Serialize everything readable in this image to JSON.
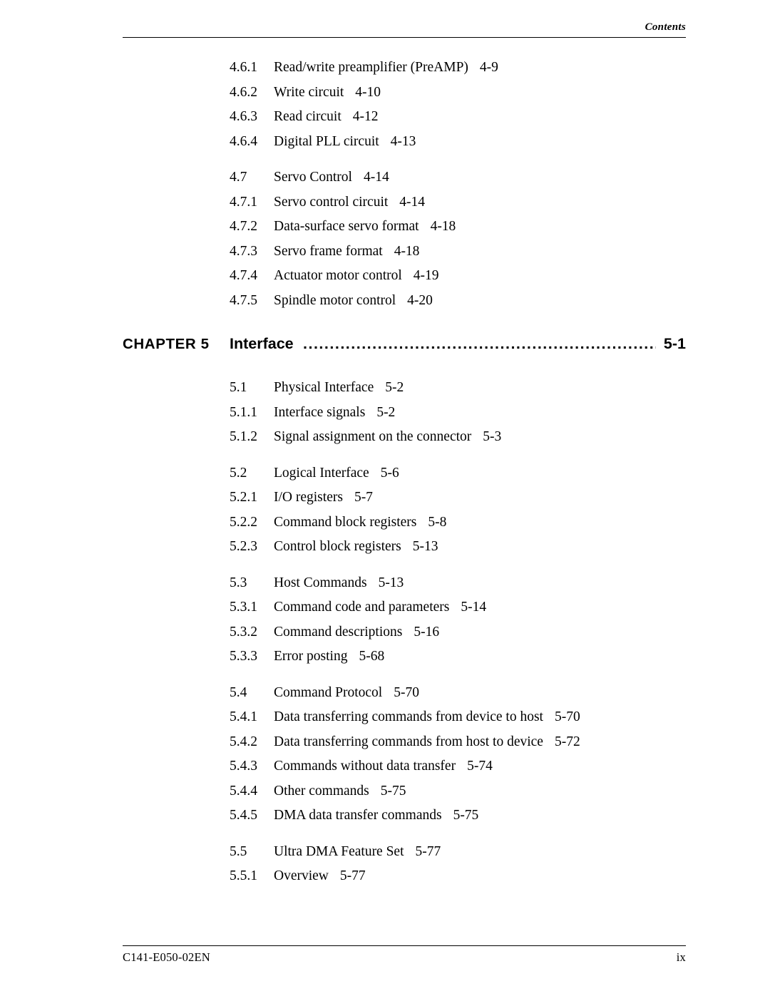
{
  "header": {
    "text": "Contents"
  },
  "footer": {
    "doc_id": "C141-E050-02EN",
    "page_number": "ix"
  },
  "chapter": {
    "label": "CHAPTER 5",
    "title": "Interface",
    "dots": "...........................................................................................",
    "page": "5-1"
  },
  "entries_top": [
    {
      "num": "4.6.1",
      "title": "Read/write preamplifier (PreAMP)",
      "page": "4-9"
    },
    {
      "num": "4.6.2",
      "title": "Write circuit",
      "page": "4-10"
    },
    {
      "num": "4.6.3",
      "title": "Read circuit",
      "page": "4-12"
    },
    {
      "num": "4.6.4",
      "title": "Digital PLL circuit",
      "page": "4-13"
    },
    {
      "gap": true
    },
    {
      "num": "4.7",
      "title": "Servo Control",
      "page": "4-14"
    },
    {
      "num": "4.7.1",
      "title": "Servo control circuit",
      "page": "4-14"
    },
    {
      "num": "4.7.2",
      "title": "Data-surface servo format",
      "page": "4-18"
    },
    {
      "num": "4.7.3",
      "title": "Servo frame format",
      "page": "4-18"
    },
    {
      "num": "4.7.4",
      "title": "Actuator motor control",
      "page": "4-19"
    },
    {
      "num": "4.7.5",
      "title": "Spindle motor control",
      "page": "4-20"
    }
  ],
  "entries_bottom": [
    {
      "num": "5.1",
      "title": "Physical Interface",
      "page": "5-2"
    },
    {
      "num": "5.1.1",
      "title": "Interface signals",
      "page": "5-2"
    },
    {
      "num": "5.1.2",
      "title": "Signal assignment on the connector",
      "page": "5-3"
    },
    {
      "gap": true
    },
    {
      "num": "5.2",
      "title": "Logical Interface",
      "page": "5-6"
    },
    {
      "num": "5.2.1",
      "title": "I/O registers",
      "page": "5-7"
    },
    {
      "num": "5.2.2",
      "title": "Command block registers",
      "page": "5-8"
    },
    {
      "num": "5.2.3",
      "title": "Control block registers",
      "page": "5-13"
    },
    {
      "gap": true
    },
    {
      "num": "5.3",
      "title": "Host Commands",
      "page": "5-13"
    },
    {
      "num": "5.3.1",
      "title": "Command code and parameters",
      "page": "5-14"
    },
    {
      "num": "5.3.2",
      "title": "Command descriptions",
      "page": "5-16"
    },
    {
      "num": "5.3.3",
      "title": "Error posting",
      "page": "5-68"
    },
    {
      "gap": true
    },
    {
      "num": "5.4",
      "title": "Command Protocol",
      "page": "5-70"
    },
    {
      "num": "5.4.1",
      "title": "Data transferring commands from device to host",
      "page": "5-70"
    },
    {
      "num": "5.4.2",
      "title": "Data transferring commands from host to device",
      "page": "5-72"
    },
    {
      "num": "5.4.3",
      "title": "Commands without data transfer",
      "page": "5-74"
    },
    {
      "num": "5.4.4",
      "title": "Other commands",
      "page": "5-75"
    },
    {
      "num": "5.4.5",
      "title": "DMA data transfer commands",
      "page": "5-75"
    },
    {
      "gap": true
    },
    {
      "num": "5.5",
      "title": "Ultra DMA Feature Set",
      "page": "5-77"
    },
    {
      "num": "5.5.1",
      "title": "Overview",
      "page": "5-77"
    }
  ]
}
